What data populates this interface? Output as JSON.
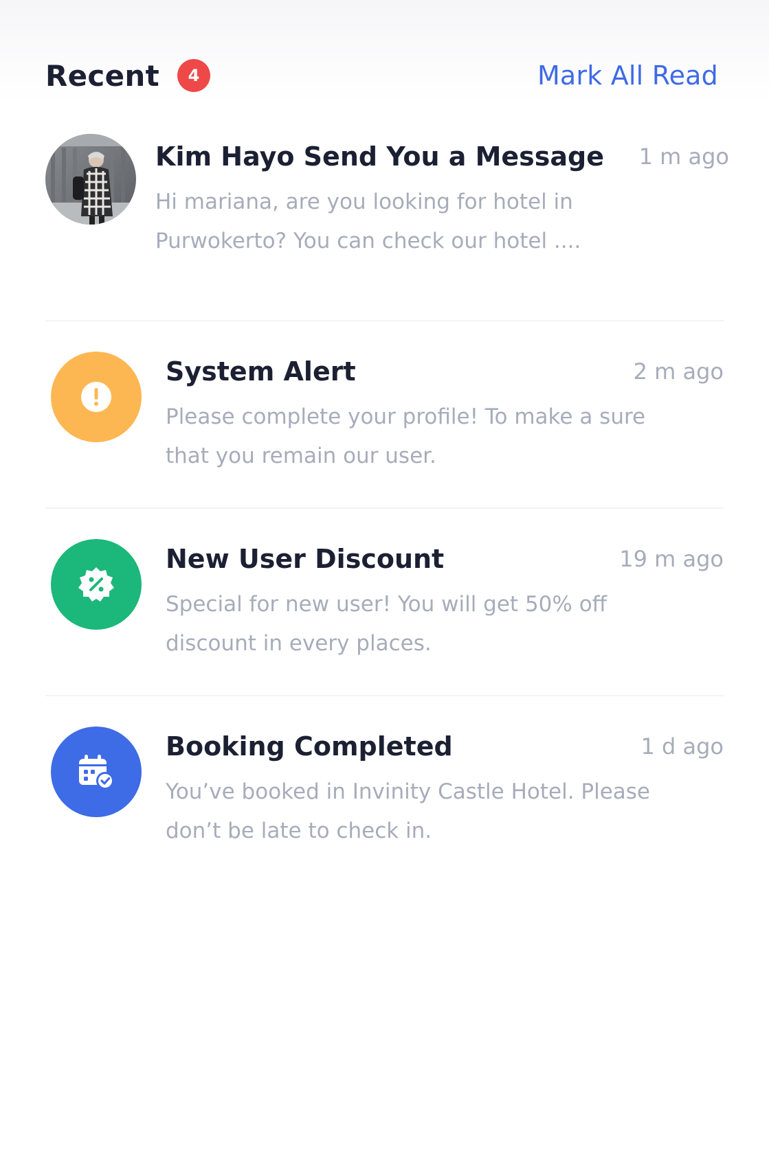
{
  "header": {
    "title": "Recent",
    "badge_count": "4",
    "mark_all_label": "Mark All Read"
  },
  "colors": {
    "accent": "#3f6ae5",
    "badge": "#ef4848",
    "alert": "#fdb752",
    "discount": "#1cb77a",
    "booking": "#3e6be6"
  },
  "notifications": [
    {
      "title": "Kim Hayo Send You a Message",
      "time": "1 m ago",
      "description": "Hi mariana, are you looking for hotel in Purwokerto? You can check our hotel ....",
      "icon": "avatar-photo"
    },
    {
      "title": "System Alert",
      "time": "2 m ago",
      "description": "Please complete your profile! To make a sure that you remain our user.",
      "icon": "alert-icon"
    },
    {
      "title": "New User Discount",
      "time": "19 m ago",
      "description": "Special for new user! You will get 50% off discount in every places.",
      "icon": "discount-badge-icon"
    },
    {
      "title": "Booking Completed",
      "time": "1 d ago",
      "description": "You’ve booked in Invinity Castle Hotel. Please don’t be late to check in.",
      "icon": "calendar-check-icon"
    }
  ]
}
